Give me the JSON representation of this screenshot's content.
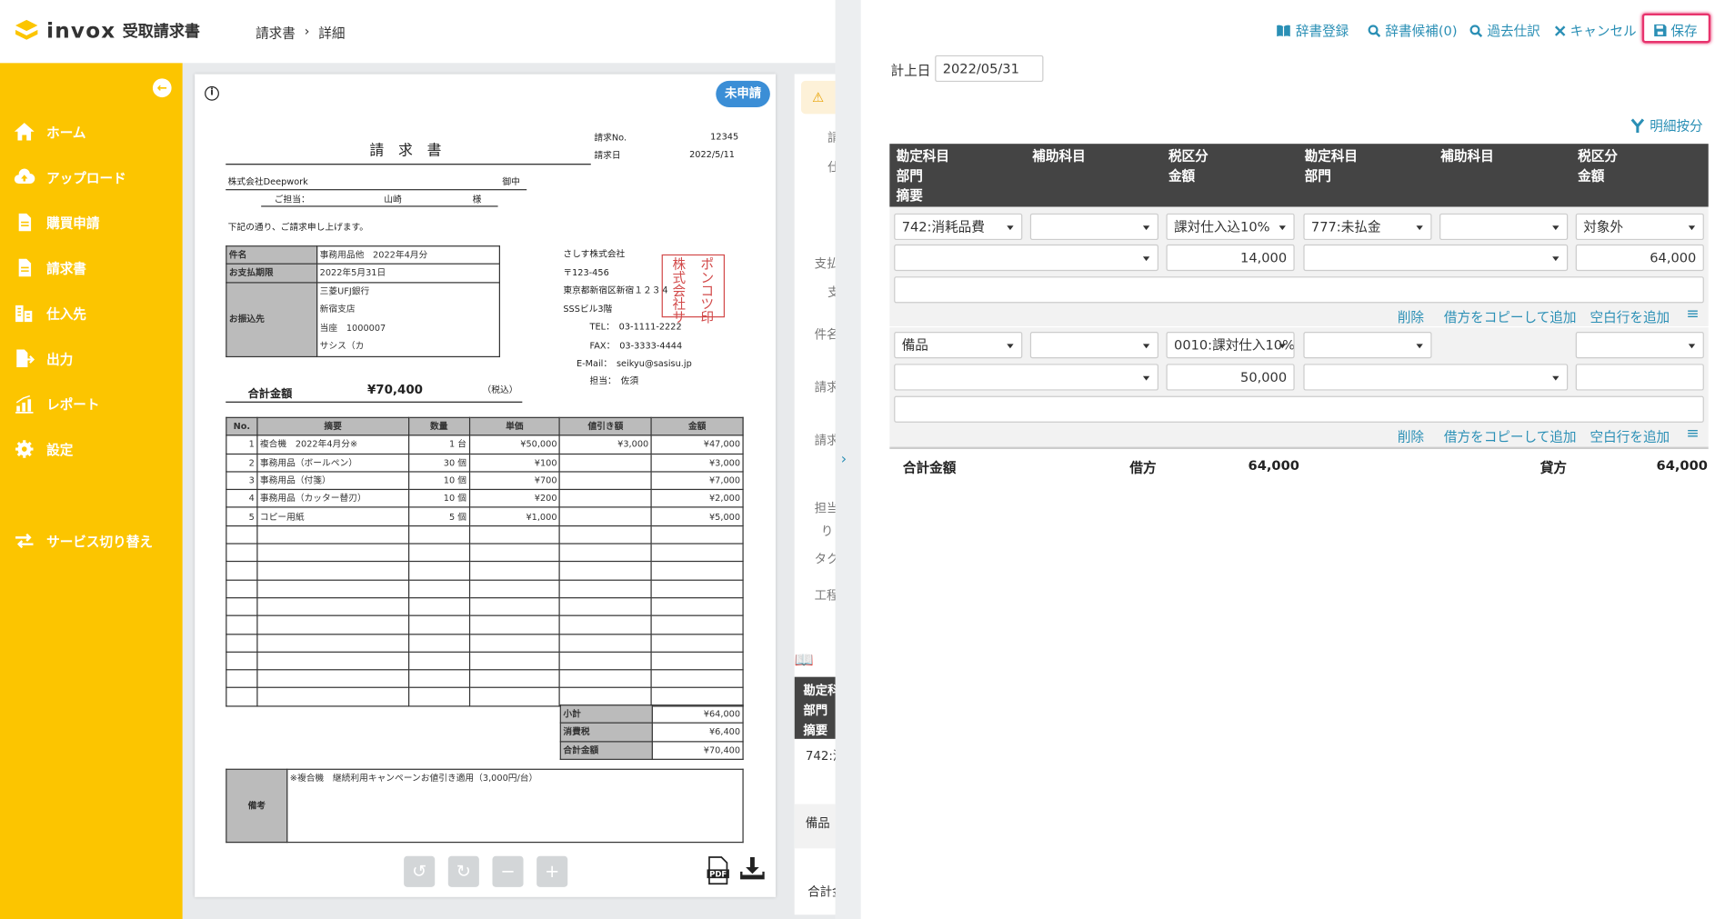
{
  "app": {
    "brand": "invox",
    "product": "受取請求書"
  },
  "breadcrumb": {
    "root": "請求書",
    "sep": "›",
    "current": "詳細"
  },
  "sidebar": {
    "items": [
      {
        "label": "ホーム",
        "icon": "home-icon"
      },
      {
        "label": "アップロード",
        "icon": "cloud-upload-icon"
      },
      {
        "label": "購買申請",
        "icon": "document-icon"
      },
      {
        "label": "請求書",
        "icon": "invoice-icon"
      },
      {
        "label": "仕入先",
        "icon": "building-icon"
      },
      {
        "label": "出力",
        "icon": "export-icon"
      },
      {
        "label": "レポート",
        "icon": "chart-icon"
      },
      {
        "label": "設定",
        "icon": "gear-icon"
      },
      {
        "label": "サービス切り替え",
        "icon": "switch-icon"
      }
    ]
  },
  "document": {
    "status": "未申請",
    "title": "請　求　書",
    "no_label": "請求No.",
    "no": "12345",
    "date_label": "請求日",
    "date": "2022/5/11",
    "client": "株式会社Deepwork",
    "onchu": "御中",
    "tantou_label": "ご担当：",
    "tantou": "山崎",
    "sama": "様",
    "greeting": "下記の通り、ご請求申し上げます。",
    "rows": [
      [
        "件名",
        "事務用品他　2022年4月分"
      ],
      [
        "お支払期限",
        "2022年5月31日"
      ]
    ],
    "bank_label": "お振込先",
    "bank_lines": [
      "三菱UFJ銀行",
      "新宿支店",
      "当座　1000007",
      "サシス（カ"
    ],
    "sender": [
      "さしす株式会社",
      "〒123-456",
      "東京都新宿区新宿１２３４",
      "SSSビル3階"
    ],
    "tel": "TEL：　03-1111-2222",
    "fax": "FAX：　03-3333-4444",
    "email": "E-Mail：　seikyu@sasisu.jp",
    "sender_tantou": "担当：　佐須",
    "stamp": [
      "株",
      "ポ",
      "式",
      "ン",
      "会",
      "コ",
      "社",
      "ツ",
      "サ",
      "印"
    ],
    "total_label": "合計金額",
    "total": "¥70,400",
    "tax_note": "（税込）",
    "headers": [
      "No.",
      "摘要",
      "数量",
      "単価",
      "値引き額",
      "金額"
    ],
    "items": [
      [
        "1",
        "複合機　2022年4月分※",
        "1 台",
        "¥50,000",
        "¥3,000",
        "¥47,000"
      ],
      [
        "2",
        "事務用品（ボールペン）",
        "30 個",
        "¥100",
        "",
        "¥3,000"
      ],
      [
        "3",
        "事務用品（付箋）",
        "10 個",
        "¥700",
        "",
        "¥7,000"
      ],
      [
        "4",
        "事務用品（カッター替刃）",
        "10 個",
        "¥200",
        "",
        "¥2,000"
      ],
      [
        "5",
        "コピー用紙",
        "5 個",
        "¥1,000",
        "",
        "¥5,000"
      ]
    ],
    "summary": [
      [
        "小計",
        "¥64,000"
      ],
      [
        "消費税",
        "¥6,400"
      ],
      [
        "合計金額",
        "¥70,400"
      ]
    ],
    "note_label": "備考",
    "note": "※複合機　継続利用キャンペーンお値引き適用（3,000円/台）"
  },
  "toolbar": {
    "undo": "↺",
    "redo": "↻",
    "zoom_out": "−",
    "zoom_in": "+",
    "pdf": "PDF"
  },
  "peek": [
    "請",
    "仕",
    "支払",
    "支",
    "件名",
    "請求",
    "請求",
    "担当",
    "り",
    "タク",
    "工程",
    "勘定科",
    "部門",
    "摘要",
    "742:消",
    "備品",
    "合計金"
  ],
  "actions": {
    "dict_register": "辞書登録",
    "dict_candidates": "辞書候補(0)",
    "past": "過去仕訳",
    "cancel": "キャンセル",
    "save": "保存"
  },
  "journal": {
    "date_label": "計上日",
    "date": "2022/05/31",
    "split": "明細按分",
    "headers": [
      [
        "勘定科目",
        "部門",
        "摘要"
      ],
      [
        "補助科目"
      ],
      [
        "税区分",
        "金額"
      ],
      [
        "勘定科目",
        "部門"
      ],
      [
        "補助科目"
      ],
      [
        "税区分",
        "金額"
      ]
    ],
    "entries": [
      {
        "debit_account": "742:消耗品費",
        "debit_sub": "",
        "debit_tax": "課対仕入込10%",
        "credit_account": "777:未払金",
        "credit_sub": "",
        "credit_tax": "対象外",
        "debit_dept": "",
        "debit_amount": "14,000",
        "credit_dept": "",
        "credit_amount": "64,000",
        "memo": ""
      },
      {
        "debit_account": "備品",
        "debit_sub": "",
        "debit_tax": "0010:課対仕入10%",
        "credit_account": "",
        "credit_sub": "",
        "credit_tax": "",
        "debit_dept": "",
        "debit_amount": "50,000",
        "credit_dept": "",
        "credit_amount": "",
        "memo": ""
      }
    ],
    "row_actions": {
      "delete": "削除",
      "copy": "借方をコピーして追加",
      "blank": "空白行を追加"
    },
    "totals": {
      "label": "合計金額",
      "debit_label": "借方",
      "debit": "64,000",
      "credit_label": "貸方",
      "credit": "64,000"
    }
  },
  "colors": {
    "brand": "#fcc500",
    "accent": "#2a8fb5",
    "badge": "#3b8ed6",
    "save_highlight": "#e8336d"
  }
}
